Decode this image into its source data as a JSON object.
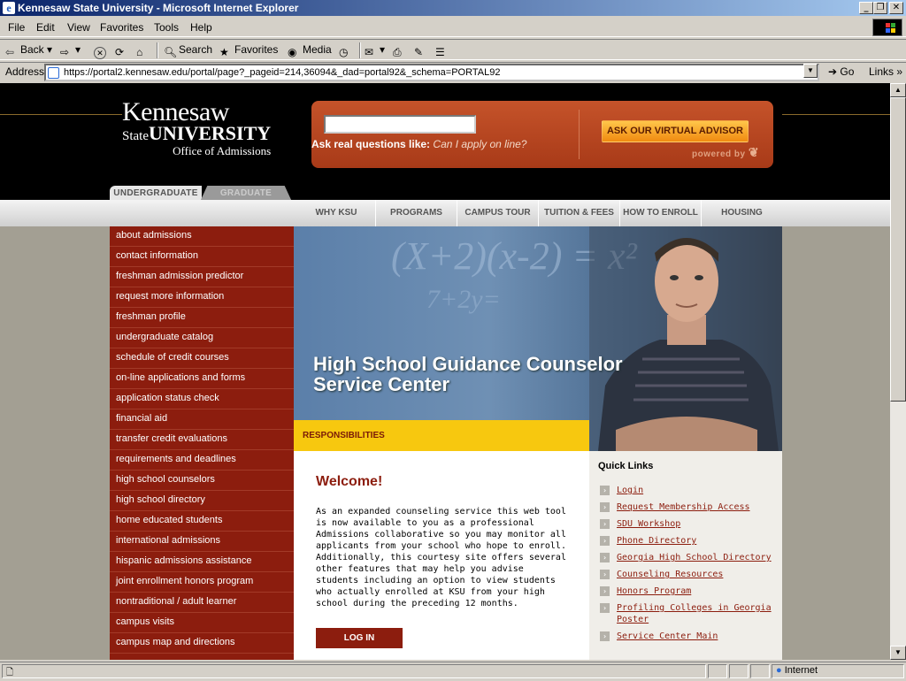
{
  "window": {
    "title": "Kennesaw State University - Microsoft Internet Explorer"
  },
  "menu": [
    "File",
    "Edit",
    "View",
    "Favorites",
    "Tools",
    "Help"
  ],
  "toolbar": {
    "back": "Back",
    "search": "Search",
    "favorites": "Favorites",
    "media": "Media"
  },
  "address": {
    "label": "Address",
    "url": "https://portal2.kennesaw.edu/portal/page?_pageid=214,36094&_dad=portal92&_schema=PORTAL92",
    "go": "Go",
    "links": "Links"
  },
  "logo": {
    "line1": "Kennesaw",
    "state": "State",
    "university": "UNIVERSITY",
    "office": "Office of Admissions"
  },
  "advisor": {
    "ask_prefix": "Ask real questions like:",
    "ask_example": "Can I apply on line?",
    "button": "ASK OUR VIRTUAL ADVISOR",
    "powered": "powered by"
  },
  "tabs": [
    "UNDERGRADUATE",
    "GRADUATE"
  ],
  "nav": [
    "WHY KSU",
    "PROGRAMS",
    "CAMPUS TOUR",
    "TUITION & FEES",
    "HOW TO ENROLL",
    "HOUSING"
  ],
  "sidebar": [
    "about admissions",
    "contact information",
    "freshman admission predictor",
    "request more information",
    "freshman profile",
    "undergraduate catalog",
    "schedule of credit courses",
    "on-line applications and forms",
    "application status check",
    "financial aid",
    "transfer credit evaluations",
    "requirements and deadlines",
    "high school counselors",
    "high school directory",
    "home educated students",
    "international admissions",
    "hispanic admissions assistance",
    "joint enrollment honors program",
    "nontraditional / adult learner",
    "campus visits",
    "campus map and directions"
  ],
  "hero": {
    "line1": "High School Guidance Counselor",
    "line2": "Service Center",
    "eq": "(X+2)(x-2) = x²",
    "eq2": "7+2y="
  },
  "responsibilities": "RESPONSIBILITIES",
  "welcome": {
    "title": "Welcome!",
    "body": "As an expanded counseling service this web tool is now available to you as a professional Admissions collaborative so you may monitor all applicants from your school who hope to enroll. Additionally, this courtesy site offers several other features that may help you advise students including an option to view students who actually enrolled at KSU from your high school during the preceding 12 months.",
    "login": "LOG IN"
  },
  "quicklinks": {
    "title": "Quick Links",
    "items": [
      "Login",
      "Request Membership Access",
      "SDU Workshop",
      "Phone Directory",
      "Georgia High School Directory",
      "Counseling Resources",
      "Honors Program",
      "Profiling Colleges in Georgia Poster",
      "Service Center Main"
    ]
  },
  "status": {
    "zone": "Internet"
  },
  "colors": {
    "maroon": "#8c1d0e",
    "gold": "#f7c80f",
    "orange": "#c5532a"
  }
}
